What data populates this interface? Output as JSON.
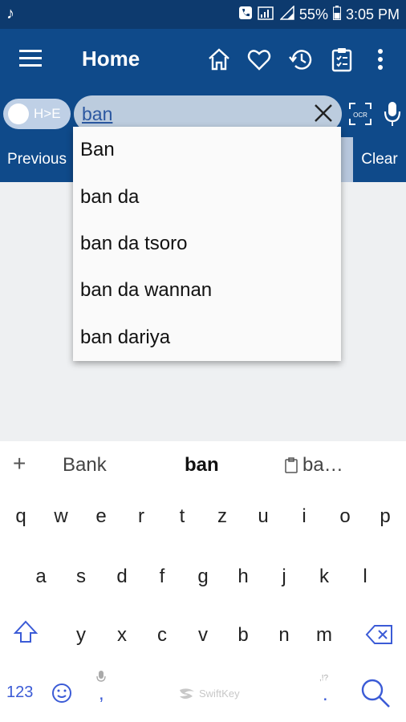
{
  "status_bar": {
    "left_icon": "music-note-icon",
    "battery": "55%",
    "time": "3:05 PM"
  },
  "app_bar": {
    "title": "Home",
    "icons": [
      "menu-icon",
      "home-icon",
      "heart-icon",
      "history-icon",
      "clipboard-icon",
      "more-vert-icon"
    ]
  },
  "search": {
    "toggle_label": "H>E",
    "query": "ban"
  },
  "nav": {
    "previous_label": "Previous",
    "clear_label": "Clear"
  },
  "suggestions": [
    "Ban",
    "ban da",
    "ban da tsoro",
    "ban da wannan",
    "ban dariya"
  ],
  "keyboard": {
    "predictions": [
      "Bank",
      "ban",
      "ba…"
    ],
    "row1": [
      "q",
      "w",
      "e",
      "r",
      "t",
      "z",
      "u",
      "i",
      "o",
      "p"
    ],
    "row2": [
      "a",
      "s",
      "d",
      "f",
      "g",
      "h",
      "j",
      "k",
      "l"
    ],
    "row3": [
      "y",
      "x",
      "c",
      "v",
      "b",
      "n",
      "m"
    ],
    "numbers_label": "123",
    "brand": "SwiftKey",
    "punct_comma": ",",
    "punct_dot": ".",
    "punct_hint": ",!?"
  },
  "colors": {
    "primary": "#0f4a8a",
    "status": "#0d3a6e",
    "accent": "#3b5bd6"
  }
}
